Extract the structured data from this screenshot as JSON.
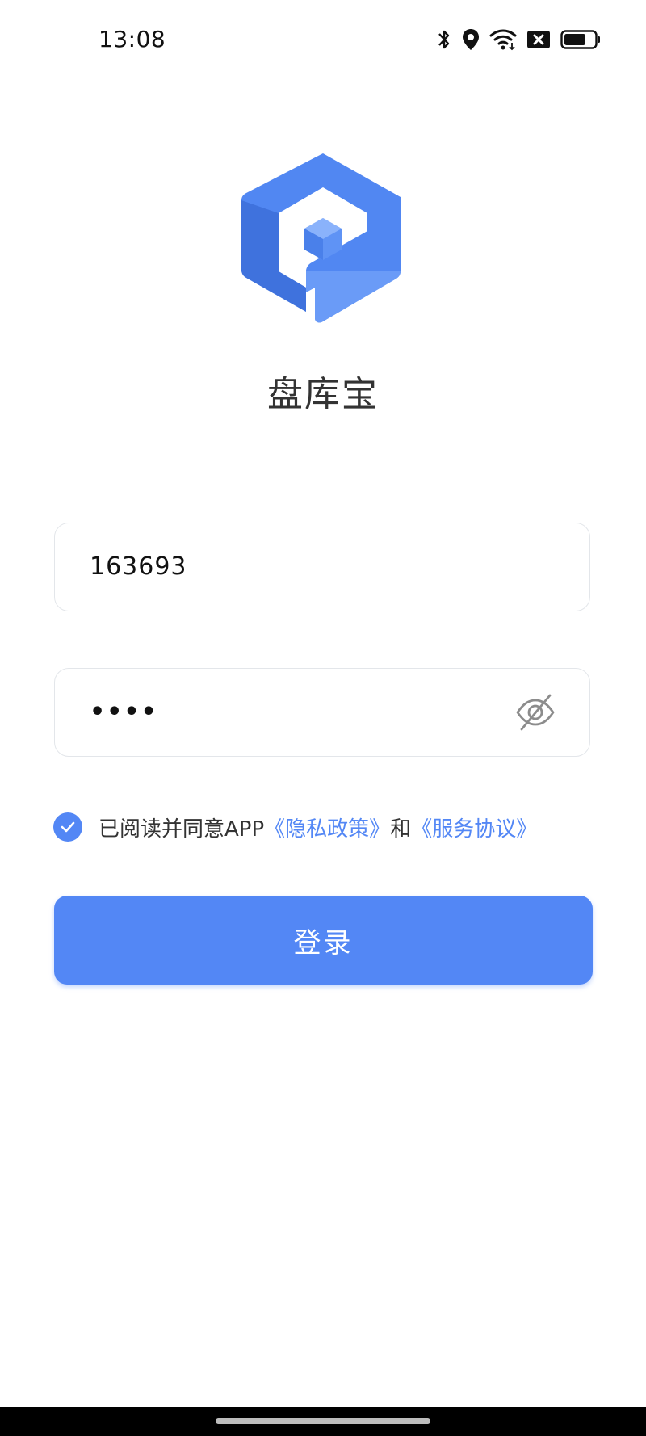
{
  "status_bar": {
    "time": "13:08",
    "icons": [
      "bluetooth-icon",
      "location-icon",
      "wifi-icon",
      "no-sim-icon",
      "battery-icon"
    ]
  },
  "app": {
    "logo": "app-logo",
    "name": "盘库宝"
  },
  "login_form": {
    "username_value": "163693",
    "password_masked": "••••",
    "password_toggle_icon": "eye-off-icon"
  },
  "agreement": {
    "checked": true,
    "prefix": "已阅读并同意APP",
    "privacy_link": "《隐私政策》",
    "conjunction": "和",
    "service_link": "《服务协议》"
  },
  "login_button_label": "登录",
  "colors": {
    "accent": "#5387f5",
    "logo_blue": "#4f86f0",
    "text": "#333333",
    "border": "#e3e6ea"
  }
}
